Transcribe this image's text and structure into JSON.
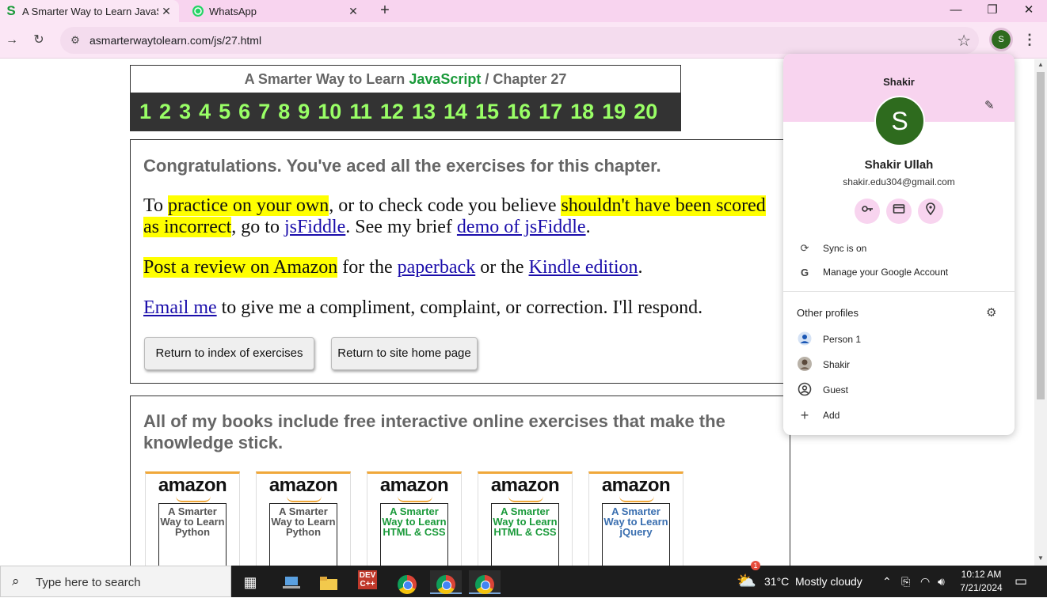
{
  "tabs": [
    {
      "title": "A Smarter Way to Learn JavaScript",
      "favicon": "S",
      "active": true
    },
    {
      "title": "WhatsApp",
      "favicon": "whatsapp-icon",
      "active": false
    }
  ],
  "tab_close": "✕",
  "new_tab": "+",
  "window_controls": {
    "minimize": "—",
    "restore": "❐",
    "close": "✕"
  },
  "nav": {
    "back": "→",
    "reload": "↻"
  },
  "address": {
    "url": "asmarterwaytolearn.com/js/27.html",
    "site_info": "⚙",
    "bookmark": "☆"
  },
  "profile_button_letter": "S",
  "menu_dots": "⋮",
  "chapter": {
    "title_prefix": "A Smarter Way to Learn ",
    "title_js": "JavaScript",
    "title_suffix": " / Chapter 27",
    "numbers": [
      "1",
      "2",
      "3",
      "4",
      "5",
      "6",
      "7",
      "8",
      "9",
      "10",
      "11",
      "12",
      "13",
      "14",
      "15",
      "16",
      "17",
      "18",
      "19",
      "20"
    ]
  },
  "congrats": {
    "title": "Congratulations. You've aced all the exercises for this chapter.",
    "p1": {
      "t1": "To ",
      "h1": "practice on your own",
      "t2": ", or to check code you believe ",
      "h2": "shouldn't have been scored as incorrect",
      "t3": ", go to ",
      "l1": "jsFiddle",
      "t4": ". See my brief ",
      "l2": "demo of jsFiddle",
      "t5": "."
    },
    "p2": {
      "h1": "Post a review on Amazon",
      "t1": " for the ",
      "l1": "paperback",
      "t2": " or the ",
      "l2": "Kindle edition",
      "t3": "."
    },
    "p3": {
      "l1": "Email me",
      "t1": " to give me a compliment, complaint, or correction. I'll respond."
    },
    "buttons": {
      "index": "Return to index of exercises",
      "home": "Return to site home page"
    }
  },
  "books": {
    "title": "All of my books include free interactive online exercises that make the knowledge stick.",
    "brand": "amazon",
    "items": [
      {
        "cover": "A Smarter Way to Learn Python",
        "color": "#555555"
      },
      {
        "cover": "A Smarter Way to Learn Python",
        "color": "#555555"
      },
      {
        "cover": "A Smarter Way to Learn HTML & CSS",
        "color": "#1a9a3a"
      },
      {
        "cover": "A Smarter Way to Learn HTML & CSS",
        "color": "#1a9a3a"
      },
      {
        "cover": "A Smarter Way to Learn jQuery",
        "color": "#3a6fb0"
      }
    ]
  },
  "profile_menu": {
    "header_name": "Shakir",
    "avatar_letter": "S",
    "full_name": "Shakir Ullah",
    "email": "shakir.edu304@gmail.com",
    "quick_icons": [
      "key-icon",
      "card-icon",
      "location-icon"
    ],
    "sync_label": "Sync is on",
    "manage_label": "Manage your Google Account",
    "other_profiles_title": "Other profiles",
    "profiles": [
      {
        "label": "Person 1",
        "icon": "person-icon"
      },
      {
        "label": "Shakir",
        "icon": "photo-avatar-icon"
      },
      {
        "label": "Guest",
        "icon": "guest-icon"
      },
      {
        "label": "Add",
        "icon": "plus-icon"
      }
    ]
  },
  "taskbar": {
    "search_placeholder": "Type here to search",
    "weather_temp": "31°C",
    "weather_text": "Mostly cloudy",
    "weather_badge": "1",
    "time": "10:12 AM",
    "date": "7/21/2024",
    "dev_label": "DEV C++"
  },
  "colors": {
    "accent_pink": "#f8d4ef",
    "avatar_green": "#2e6b1e",
    "highlight": "#ffff00",
    "chapter_green": "#99ff66"
  }
}
